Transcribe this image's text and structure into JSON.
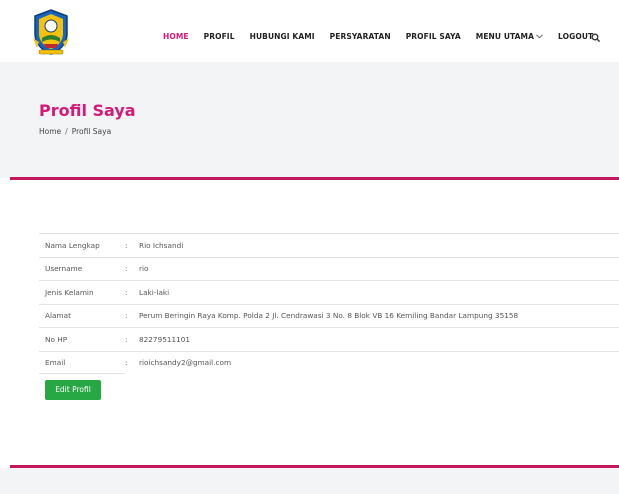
{
  "nav": {
    "items": [
      {
        "label": "HOME",
        "active": true
      },
      {
        "label": "PROFIL",
        "active": false
      },
      {
        "label": "HUBUNGI KAMI",
        "active": false
      },
      {
        "label": "PERSYARATAN",
        "active": false
      },
      {
        "label": "PROFIL SAYA",
        "active": false
      },
      {
        "label": "MENU UTAMA",
        "active": false,
        "dropdown": true
      },
      {
        "label": "LOGOUT",
        "active": false
      }
    ],
    "search_icon": "search-icon"
  },
  "hero": {
    "title": "Profil Saya",
    "breadcrumb": {
      "home": "Home",
      "separator": "/",
      "current": "Profil Saya"
    }
  },
  "profile": {
    "rows": [
      {
        "label": "Nama Lengkap",
        "colon": ":",
        "value": "Rio Ichsandi"
      },
      {
        "label": "Username",
        "colon": ":",
        "value": "rio"
      },
      {
        "label": "Jenis Kelamin",
        "colon": ":",
        "value": "Laki-laki"
      },
      {
        "label": "Alamat",
        "colon": ":",
        "value": "Perum Beringin Raya Komp. Polda 2 Jl. Cendrawasi 3 No. 8 Blok VB 16 Kemiling Bandar Lampung 35158"
      },
      {
        "label": "No HP",
        "colon": ":",
        "value": "82279511101"
      },
      {
        "label": "Email",
        "colon": ":",
        "value": "rioichsandy2@gmail.com"
      }
    ],
    "edit_button": "Edit Profil"
  },
  "colors": {
    "accent": "#d41a77",
    "divider": "#c2185b",
    "button": "#28a745",
    "band": "#f3f4f6"
  }
}
